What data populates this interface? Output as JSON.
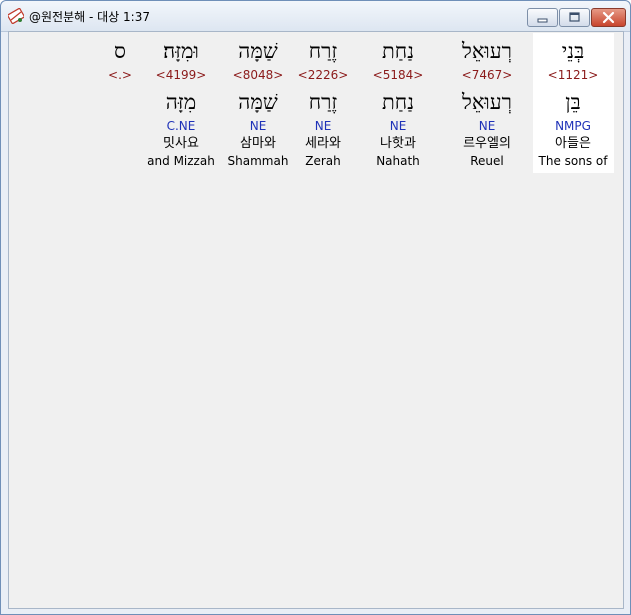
{
  "window": {
    "title": "@원전분해 - 대상 1:37"
  },
  "words": [
    {
      "hebrew": "בְּנֵי",
      "strong": "<1121>",
      "lemma": "בֵּן",
      "morph": "NMPG",
      "korean": "아들은",
      "english": "The sons of",
      "highlighted": true
    },
    {
      "hebrew": "רְעוּאֵל",
      "strong": "<7467>",
      "lemma": "רְעוּאֵל",
      "morph": "NE",
      "korean": "르우엘의",
      "english": "Reuel"
    },
    {
      "hebrew": "נַחַת",
      "strong": "<5184>",
      "lemma": "נַחַת",
      "morph": "NE",
      "korean": "나핫과",
      "english": "Nahath"
    },
    {
      "hebrew": "זֶרַח",
      "strong": "<2226>",
      "lemma": "זֶרַח",
      "morph": "NE",
      "korean": "세라와",
      "english": "Zerah"
    },
    {
      "hebrew": "שַׁמָּה",
      "strong": "<8048>",
      "lemma": "שַׁמָּה",
      "morph": "NE",
      "korean": "삼마와",
      "english": "Shammah"
    },
    {
      "hebrew": "וּמִזָּה׃",
      "strong": "<4199>",
      "lemma": "מִזָּה",
      "morph": "C.NE",
      "korean": "밋사요",
      "english": "and Mizzah"
    },
    {
      "hebrew": "ס",
      "strong": "<.>",
      "lemma": "",
      "morph": "",
      "korean": "",
      "english": ""
    }
  ],
  "colors": {
    "strong_number": "#8b1a1a",
    "morph_code": "#1f32b8",
    "highlight_background": "#ffffff"
  },
  "icons": {
    "app": "bible-app-icon",
    "minimize": "minimize-icon",
    "maximize": "maximize-icon",
    "close": "close-icon"
  }
}
